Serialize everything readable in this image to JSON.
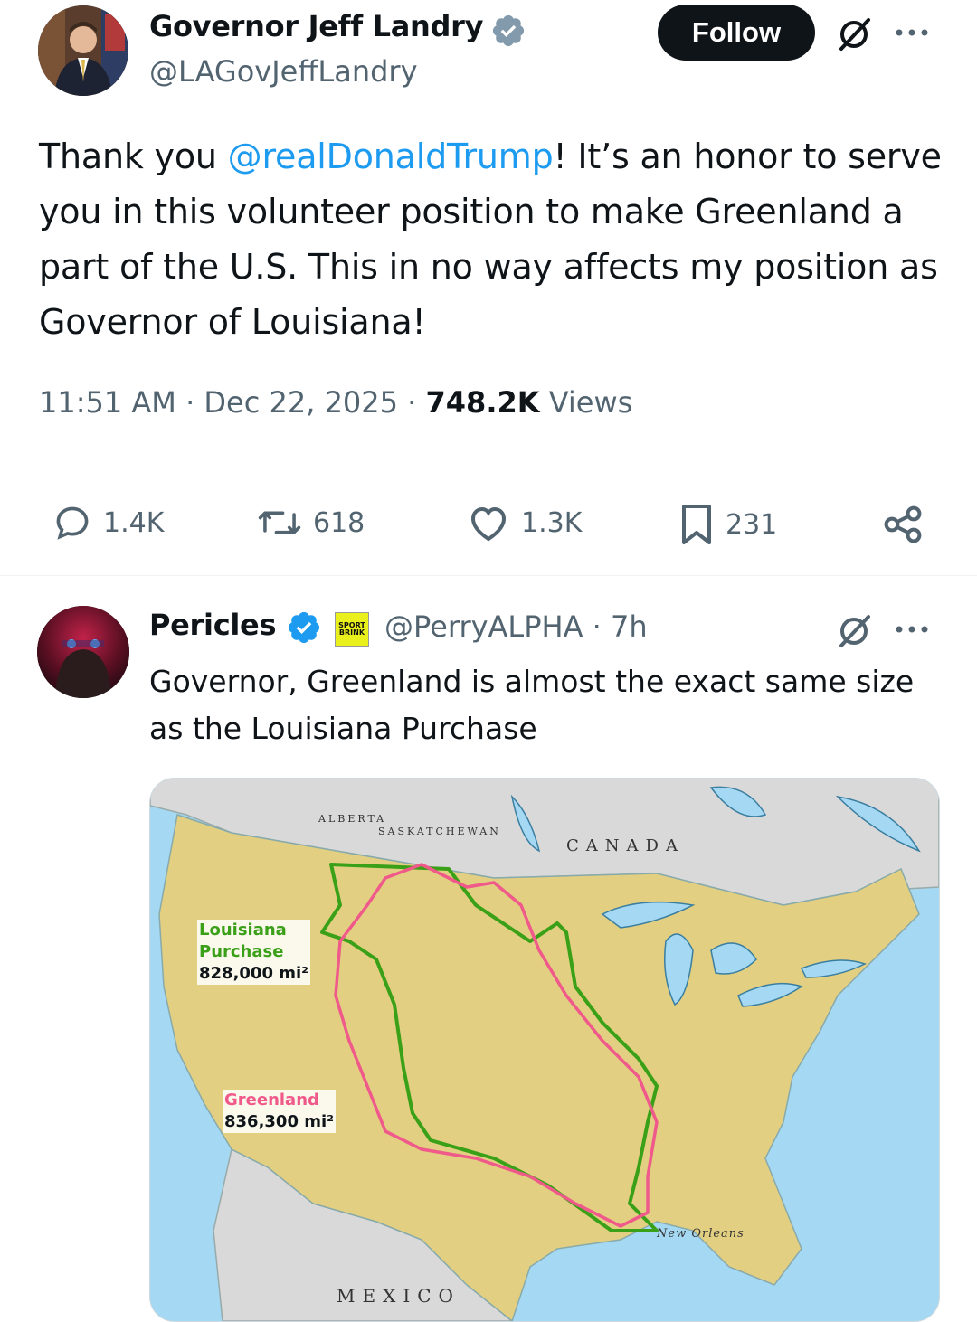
{
  "main_tweet": {
    "author_name": "Governor Jeff Landry",
    "handle": "@LAGovJeffLandry",
    "follow_label": "Follow",
    "text_before": "Thank you ",
    "mention": "@realDonaldTrump",
    "text_after": "! It’s an honor to serve you in this volunteer position to make Greenland a part of the U.S. This in no way affects my position as Governor of Louisiana!",
    "time": "11:51 AM",
    "date": "Dec 22, 2025",
    "views_count": "748.2K",
    "views_label": "Views",
    "stats": {
      "replies": "1.4K",
      "reposts": "618",
      "likes": "1.3K",
      "bookmarks": "231"
    }
  },
  "reply": {
    "author_name": "Pericles",
    "handle": "@PerryALPHA",
    "age": "7h",
    "badge_text": "SPORT BRINK",
    "text": "Governor, Greenland is almost the exact same size as the Louisiana Purchase",
    "map": {
      "labels": {
        "alberta": "ALBERTA",
        "saskatchewan": "SASKATCHEWAN",
        "canada": "CANADA",
        "mexico": "MEXICO",
        "new_orleans": "New Orleans"
      },
      "louisiana_label_1": "Louisiana",
      "louisiana_label_2": "Purchase",
      "louisiana_area": "828,000 mi²",
      "greenland_label": "Greenland",
      "greenland_area": "836,300 mi²",
      "colors": {
        "water": "#a5d8f2",
        "us_land": "#e2cf82",
        "other_land": "#d9d9d9",
        "louisiana_outline": "#3aa018",
        "greenland_outline": "#ef5a8a"
      }
    }
  },
  "colors": {
    "accent": "#1d9bf0",
    "text": "#0f1419",
    "secondary": "#536471"
  }
}
